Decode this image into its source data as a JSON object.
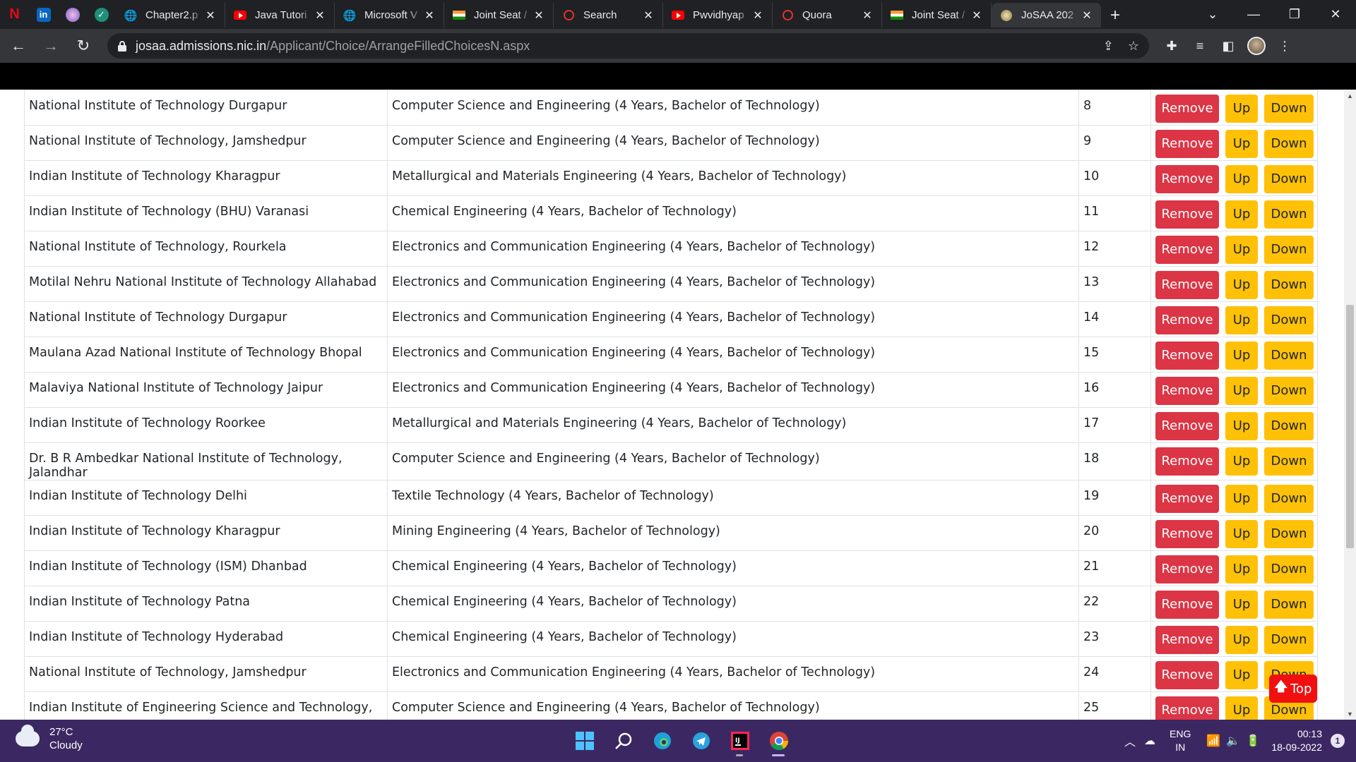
{
  "browser": {
    "tabs": [
      {
        "title": "Chapter2.p",
        "favicon": "globe-icon"
      },
      {
        "title": "Java Tutori",
        "favicon": "youtube-icon"
      },
      {
        "title": "Microsoft V",
        "favicon": "globe-icon"
      },
      {
        "title": "Joint Seat /",
        "favicon": "india-flag-icon"
      },
      {
        "title": "Search",
        "favicon": "quora-icon"
      },
      {
        "title": "Pwvidhyap",
        "favicon": "youtube-icon"
      },
      {
        "title": "Quora",
        "favicon": "quora-icon"
      },
      {
        "title": "Joint Seat /",
        "favicon": "india-flag-icon"
      },
      {
        "title": "JoSAA 202",
        "favicon": "josaa-emblem-icon"
      }
    ],
    "url_host": "josaa.admissions.nic.in",
    "url_path": "/Applicant/Choice/ArrangeFilledChoicesN.aspx"
  },
  "choices": {
    "buttons": {
      "remove": "Remove",
      "up": "Up",
      "down": "Down"
    },
    "rows": [
      {
        "institute": "National Institute of Technology Durgapur",
        "program": "Computer Science and Engineering (4 Years, Bachelor of Technology)",
        "priority": "8"
      },
      {
        "institute": "National Institute of Technology, Jamshedpur",
        "program": "Computer Science and Engineering (4 Years, Bachelor of Technology)",
        "priority": "9"
      },
      {
        "institute": "Indian Institute of Technology Kharagpur",
        "program": "Metallurgical and Materials Engineering (4 Years, Bachelor of Technology)",
        "priority": "10"
      },
      {
        "institute": "Indian Institute of Technology (BHU) Varanasi",
        "program": "Chemical Engineering (4 Years, Bachelor of Technology)",
        "priority": "11"
      },
      {
        "institute": "National Institute of Technology, Rourkela",
        "program": "Electronics and Communication Engineering (4 Years, Bachelor of Technology)",
        "priority": "12"
      },
      {
        "institute": "Motilal Nehru National Institute of Technology Allahabad",
        "program": "Electronics and Communication Engineering (4 Years, Bachelor of Technology)",
        "priority": "13"
      },
      {
        "institute": "National Institute of Technology Durgapur",
        "program": "Electronics and Communication Engineering (4 Years, Bachelor of Technology)",
        "priority": "14"
      },
      {
        "institute": "Maulana Azad National Institute of Technology Bhopal",
        "program": "Electronics and Communication Engineering (4 Years, Bachelor of Technology)",
        "priority": "15"
      },
      {
        "institute": "Malaviya National Institute of Technology Jaipur",
        "program": "Electronics and Communication Engineering (4 Years, Bachelor of Technology)",
        "priority": "16"
      },
      {
        "institute": "Indian Institute of Technology Roorkee",
        "program": "Metallurgical and Materials Engineering (4 Years, Bachelor of Technology)",
        "priority": "17"
      },
      {
        "institute": "Dr. B R Ambedkar National Institute of Technology, Jalandhar",
        "program": "Computer Science and Engineering (4 Years, Bachelor of Technology)",
        "priority": "18"
      },
      {
        "institute": "Indian Institute of Technology Delhi",
        "program": "Textile Technology (4 Years, Bachelor of Technology)",
        "priority": "19"
      },
      {
        "institute": "Indian Institute of Technology Kharagpur",
        "program": "Mining Engineering (4 Years, Bachelor of Technology)",
        "priority": "20"
      },
      {
        "institute": "Indian Institute of Technology (ISM) Dhanbad",
        "program": "Chemical Engineering (4 Years, Bachelor of Technology)",
        "priority": "21"
      },
      {
        "institute": "Indian Institute of Technology Patna",
        "program": "Chemical Engineering (4 Years, Bachelor of Technology)",
        "priority": "22"
      },
      {
        "institute": "Indian Institute of Technology Hyderabad",
        "program": "Chemical Engineering (4 Years, Bachelor of Technology)",
        "priority": "23"
      },
      {
        "institute": "National Institute of Technology, Jamshedpur",
        "program": "Electronics and Communication Engineering (4 Years, Bachelor of Technology)",
        "priority": "24"
      },
      {
        "institute": "Indian Institute of Engineering Science and Technology,",
        "program": "Computer Science and Engineering (4 Years, Bachelor of Technology)",
        "priority": "25"
      }
    ]
  },
  "top_button": {
    "label": "Top",
    "icon": "arrow-up-icon"
  },
  "colors": {
    "remove": "#dc3545",
    "warning": "#ffc107",
    "top": "#f01010",
    "taskbar": "#3b2862"
  },
  "taskbar": {
    "weather": {
      "temp": "27°C",
      "condition": "Cloudy",
      "icon": "cloud-icon"
    },
    "apps": [
      "start-icon",
      "search-icon",
      "edge-icon",
      "telegram-icon",
      "intellij-icon",
      "chrome-icon"
    ],
    "language": {
      "line1": "ENG",
      "line2": "IN"
    },
    "time": "00:13",
    "date": "18-09-2022",
    "notifications": "1"
  }
}
